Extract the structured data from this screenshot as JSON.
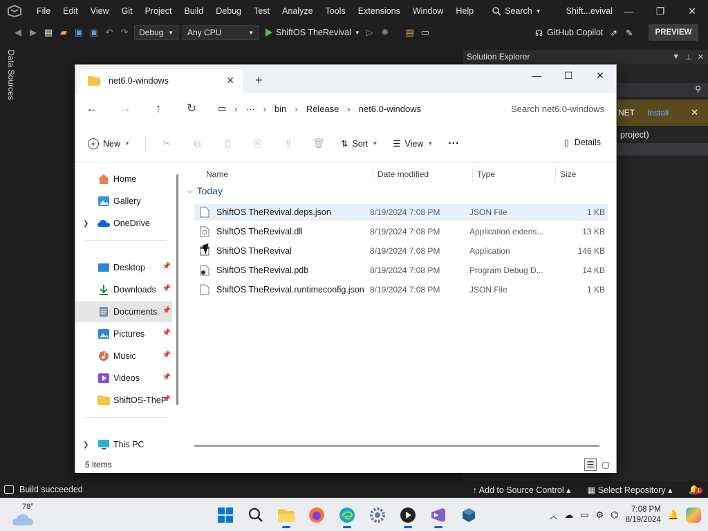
{
  "vs": {
    "menu": [
      "File",
      "Edit",
      "View",
      "Git",
      "Project",
      "Build",
      "Debug",
      "Test",
      "Analyze",
      "Tools",
      "Extensions",
      "Window",
      "Help"
    ],
    "search_label": "Search",
    "title": "Shift...evival",
    "toolbar": {
      "config": "Debug",
      "platform": "Any CPU",
      "run_target": "ShiftOS TheRevival",
      "copilot": "GitHub Copilot",
      "preview": "PREVIEW"
    },
    "left_tab": "Data Sources",
    "solution_explorer": {
      "title": "Solution Explorer",
      "banner_text": "NET",
      "banner_action": "Install",
      "project_text": "project)"
    },
    "status": {
      "build": "Build succeeded",
      "source_control": "Add to Source Control",
      "repository": "Select Repository",
      "notifications": "1"
    }
  },
  "explorer": {
    "tab_title": "net6.0-windows",
    "breadcrumb": [
      "bin",
      "Release",
      "net6.0-windows"
    ],
    "search_placeholder": "Search net6.0-windows",
    "commands": {
      "new": "New",
      "sort": "Sort",
      "view": "View",
      "details": "Details"
    },
    "nav": {
      "home": "Home",
      "gallery": "Gallery",
      "onedrive": "OneDrive",
      "desktop": "Desktop",
      "downloads": "Downloads",
      "documents": "Documents",
      "pictures": "Pictures",
      "music": "Music",
      "videos": "Videos",
      "shiftos": "ShiftOS-TheF",
      "thispc": "This PC"
    },
    "columns": {
      "name": "Name",
      "date": "Date modified",
      "type": "Type",
      "size": "Size"
    },
    "group": "Today",
    "files": [
      {
        "name": "ShiftOS TheRevival.deps.json",
        "date": "8/19/2024 7:08 PM",
        "type": "JSON File",
        "size": "1 KB"
      },
      {
        "name": "ShiftOS TheRevival.dll",
        "date": "8/19/2024 7:08 PM",
        "type": "Application extens...",
        "size": "13 KB"
      },
      {
        "name": "ShiftOS TheRevival",
        "date": "8/19/2024 7:08 PM",
        "type": "Application",
        "size": "146 KB"
      },
      {
        "name": "ShiftOS TheRevival.pdb",
        "date": "8/19/2024 7:08 PM",
        "type": "Program Debug D...",
        "size": "14 KB"
      },
      {
        "name": "ShiftOS TheRevival.runtimeconfig.json",
        "date": "8/19/2024 7:08 PM",
        "type": "JSON File",
        "size": "1 KB"
      }
    ],
    "status_items": "5 items"
  },
  "taskbar": {
    "weather_temp": "78°",
    "time": "7:08 PM",
    "date": "8/19/2024"
  }
}
